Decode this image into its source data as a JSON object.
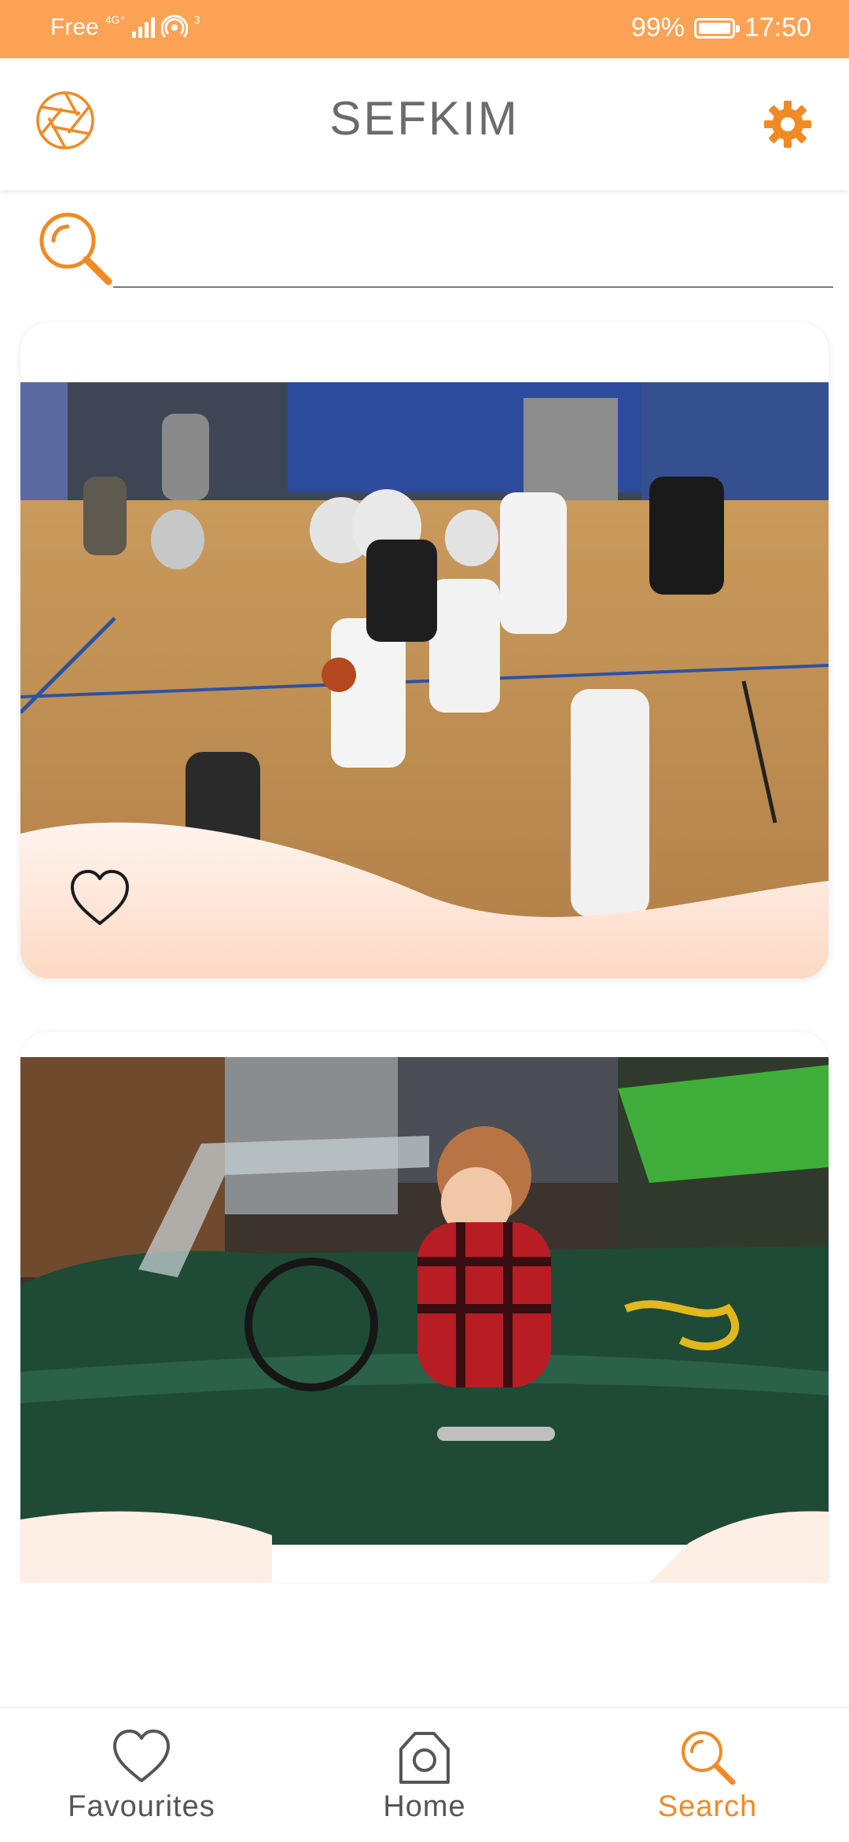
{
  "status_bar": {
    "carrier": "Free",
    "network": "4G⁺",
    "hotspot_count": "3",
    "battery": "99%",
    "time": "17:50"
  },
  "app_bar": {
    "title": "SEFKIM",
    "logo_icon": "aperture-icon",
    "settings_icon": "gear-icon"
  },
  "search": {
    "icon": "search-icon",
    "placeholder": "",
    "value": ""
  },
  "feed": {
    "cards": [
      {
        "image": "basketball-game-photo",
        "favourite_icon": "heart-outline-icon",
        "favourited": false
      },
      {
        "image": "child-in-green-convertible-photo",
        "favourite_icon": "heart-outline-icon",
        "favourited": false
      }
    ]
  },
  "bottom_nav": {
    "items": [
      {
        "label": "Favourites",
        "icon": "heart-icon",
        "active": false
      },
      {
        "label": "Home",
        "icon": "camera-icon",
        "active": false
      },
      {
        "label": "Search",
        "icon": "search-icon",
        "active": true
      }
    ]
  },
  "colors": {
    "accent": "#f08a24",
    "status_bar": "#fba254",
    "wave": "#fde1d1"
  }
}
